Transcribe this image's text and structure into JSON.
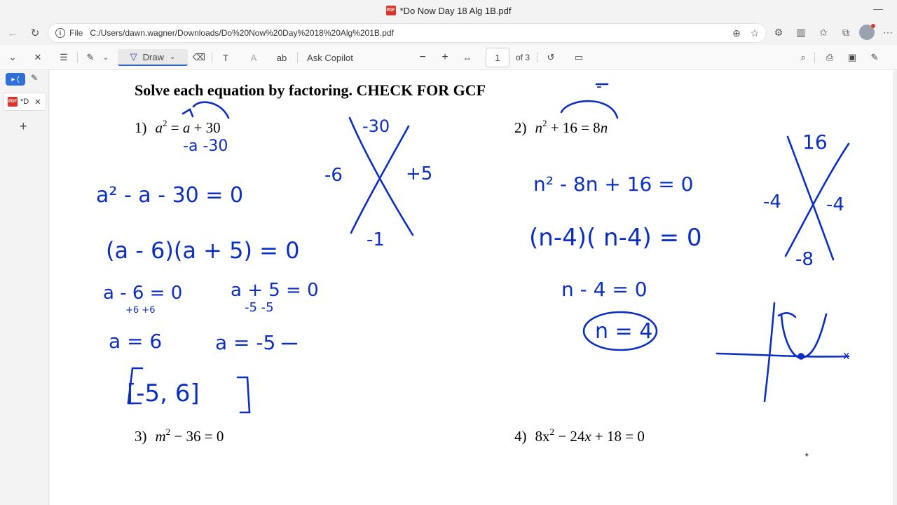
{
  "window": {
    "title": "*Do Now Day 18 Alg 1B.pdf",
    "file_badge": "PDF"
  },
  "address": {
    "scheme": "File",
    "url": "C:/Users/dawn.wagner/Downloads/Do%20Now%20Day%2018%20Alg%201B.pdf"
  },
  "toolbar": {
    "draw_label": "Draw",
    "ask_copilot_label": "Ask Copilot",
    "page_number": "1",
    "page_total": "of 3"
  },
  "sidebar": {
    "tab_label": "*D"
  },
  "worksheet": {
    "title": "Solve each equation by factoring. CHECK FOR GCF",
    "problems": [
      {
        "number": "1)",
        "var": "a",
        "exp": "2",
        "rest_a": " = ",
        "rest_b": "a",
        "rest_c": " + 30"
      },
      {
        "number": "2)",
        "var": "n",
        "exp": "2",
        "rest_a": " + 16 = 8",
        "rest_b": "n",
        "rest_c": ""
      },
      {
        "number": "3)",
        "var": "m",
        "exp": "2",
        "rest_a": " − 36 = 0",
        "rest_b": "",
        "rest_c": ""
      },
      {
        "number": "4)",
        "var": "8x",
        "exp": "2",
        "rest_a": " − 24",
        "rest_b": "x",
        "rest_c": " + 18 = 0"
      }
    ]
  },
  "handwriting": {
    "ink_color": "#0b2fc2",
    "p1_step1": "-a -30",
    "p1_x_top": "-30",
    "p1_x_left": "-6",
    "p1_x_right": "+5",
    "p1_x_bottom": "-1",
    "p1_eq": "a² - a - 30 = 0",
    "p1_factored": "(a - 6)(a + 5) = 0",
    "p1_z1": "a - 6 = 0",
    "p1_z1b": "+6   +6",
    "p1_z2": "a + 5 = 0",
    "p1_z2b": "-5    -5",
    "p1_s1": "a = 6",
    "p1_s2": "a = -5",
    "p1_answer": "[-5, 6]",
    "p2_minus": "-",
    "p2_eq": "n² - 8n + 16 = 0",
    "p2_factored": "(n-4)( n-4) = 0",
    "p2_x_top": "16",
    "p2_x_left": "-4",
    "p2_x_right": "-4",
    "p2_x_bottom": "-8",
    "p2_z": "n - 4 = 0",
    "p2_answer": "n = 4",
    "p2_graph_axis": "x"
  }
}
